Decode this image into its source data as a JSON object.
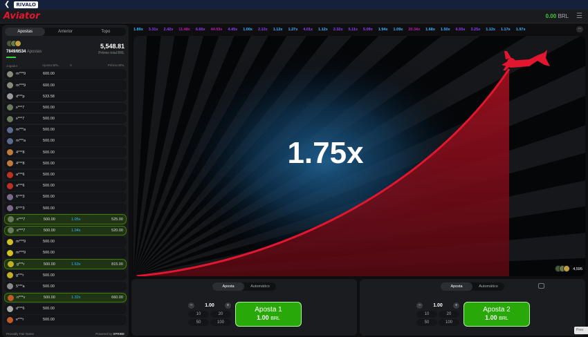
{
  "topbar": {
    "back_icon": "chevron-left-icon",
    "brand": "RIVALO"
  },
  "header": {
    "logo": "Aviator",
    "balance": "0.00",
    "currency": "BRL"
  },
  "sidebar": {
    "tabs": [
      "Apostas",
      "Anterior",
      "Topo"
    ],
    "active_tab": "Apostas",
    "players_count": "7849/8534",
    "players_label": "Apostas",
    "total": "5,548.81",
    "total_label": "Prêmio total BRL",
    "columns": {
      "player": "Jogador",
      "bet": "Aposta BRL",
      "x": "X",
      "win": "Prêmio BRL"
    },
    "rows": [
      {
        "player": "m***9",
        "bet": "600.00",
        "x": "",
        "win": "",
        "win_state": false,
        "avatar": "#8a8a7a"
      },
      {
        "player": "m***9",
        "bet": "600.00",
        "x": "",
        "win": "",
        "win_state": false,
        "avatar": "#8a8a7a"
      },
      {
        "player": "d***p",
        "bet": "533.58",
        "x": "",
        "win": "",
        "win_state": false,
        "avatar": "#9a9a9a"
      },
      {
        "player": "s***7",
        "bet": "500.00",
        "x": "",
        "win": "",
        "win_state": false,
        "avatar": "#6a7a5a"
      },
      {
        "player": "s***7",
        "bet": "500.00",
        "x": "",
        "win": "",
        "win_state": false,
        "avatar": "#6a7a5a"
      },
      {
        "player": "m***a",
        "bet": "500.00",
        "x": "",
        "win": "",
        "win_state": false,
        "avatar": "#5a6a8a"
      },
      {
        "player": "m***a",
        "bet": "500.00",
        "x": "",
        "win": "",
        "win_state": false,
        "avatar": "#5a6a8a"
      },
      {
        "player": "4***8",
        "bet": "500.00",
        "x": "",
        "win": "",
        "win_state": false,
        "avatar": "#c07a3a"
      },
      {
        "player": "4***8",
        "bet": "500.00",
        "x": "",
        "win": "",
        "win_state": false,
        "avatar": "#c07a3a"
      },
      {
        "player": "a***6",
        "bet": "500.00",
        "x": "",
        "win": "",
        "win_state": false,
        "avatar": "#c03020"
      },
      {
        "player": "a***6",
        "bet": "500.00",
        "x": "",
        "win": "",
        "win_state": false,
        "avatar": "#c03020"
      },
      {
        "player": "6***3",
        "bet": "500.00",
        "x": "",
        "win": "",
        "win_state": false,
        "avatar": "#7a6a8a"
      },
      {
        "player": "6***3",
        "bet": "500.00",
        "x": "",
        "win": "",
        "win_state": false,
        "avatar": "#7a6a8a"
      },
      {
        "player": "s***7",
        "bet": "500.00",
        "x": "1.05x",
        "win": "525.00",
        "win_state": true,
        "avatar": "#6a7a5a"
      },
      {
        "player": "s***7",
        "bet": "500.00",
        "x": "1.04x",
        "win": "520.00",
        "win_state": true,
        "avatar": "#6a7a5a"
      },
      {
        "player": "m***9",
        "bet": "500.00",
        "x": "",
        "win": "",
        "win_state": false,
        "avatar": "#d0c020"
      },
      {
        "player": "m***9",
        "bet": "500.00",
        "x": "",
        "win": "",
        "win_state": false,
        "avatar": "#d0c020"
      },
      {
        "player": "g***r",
        "bet": "500.00",
        "x": "1.63x",
        "win": "815.00",
        "win_state": true,
        "avatar": "#c0b020"
      },
      {
        "player": "g***r",
        "bet": "500.00",
        "x": "",
        "win": "",
        "win_state": false,
        "avatar": "#c0b020"
      },
      {
        "player": "5***a",
        "bet": "500.00",
        "x": "",
        "win": "",
        "win_state": false,
        "avatar": "#8a8a8a"
      },
      {
        "player": "n***v",
        "bet": "500.00",
        "x": "1.32x",
        "win": "660.00",
        "win_state": true,
        "avatar": "#c05a2a"
      },
      {
        "player": "d***6",
        "bet": "500.00",
        "x": "",
        "win": "",
        "win_state": false,
        "avatar": "#aaaaaa"
      },
      {
        "player": "e***r",
        "bet": "500.00",
        "x": "",
        "win": "",
        "win_state": false,
        "avatar": "#c05a2a"
      }
    ],
    "footer_left": "Provably Fair Game",
    "footer_right_label": "Powered by",
    "footer_right_brand": "SPRIBE"
  },
  "history": [
    {
      "v": "1.89x",
      "c": "#34b4ff"
    },
    {
      "v": "3.31x",
      "c": "#913ef8"
    },
    {
      "v": "2.42x",
      "c": "#913ef8"
    },
    {
      "v": "11.48x",
      "c": "#c017b4"
    },
    {
      "v": "6.66x",
      "c": "#913ef8"
    },
    {
      "v": "44.03x",
      "c": "#c017b4"
    },
    {
      "v": "4.45x",
      "c": "#913ef8"
    },
    {
      "v": "1.00x",
      "c": "#34b4ff"
    },
    {
      "v": "2.12x",
      "c": "#913ef8"
    },
    {
      "v": "1.12x",
      "c": "#34b4ff"
    },
    {
      "v": "1.27x",
      "c": "#34b4ff"
    },
    {
      "v": "4.01x",
      "c": "#913ef8"
    },
    {
      "v": "1.12x",
      "c": "#34b4ff"
    },
    {
      "v": "2.32x",
      "c": "#913ef8"
    },
    {
      "v": "5.11x",
      "c": "#913ef8"
    },
    {
      "v": "5.09x",
      "c": "#913ef8"
    },
    {
      "v": "1.94x",
      "c": "#34b4ff"
    },
    {
      "v": "1.09x",
      "c": "#34b4ff"
    },
    {
      "v": "20.34x",
      "c": "#c017b4"
    },
    {
      "v": "1.68x",
      "c": "#34b4ff"
    },
    {
      "v": "1.50x",
      "c": "#34b4ff"
    },
    {
      "v": "6.55x",
      "c": "#913ef8"
    },
    {
      "v": "3.25x",
      "c": "#913ef8"
    },
    {
      "v": "1.12x",
      "c": "#34b4ff"
    },
    {
      "v": "1.17x",
      "c": "#34b4ff"
    },
    {
      "v": "1.97x",
      "c": "#34b4ff"
    }
  ],
  "game": {
    "multiplier": "1.75x",
    "online_players": "4,595"
  },
  "panels": [
    {
      "tab_bet": "Aposta",
      "tab_auto": "Automático",
      "amount": "1.00",
      "quick": [
        "10",
        "20",
        "50",
        "100"
      ],
      "button_title": "Aposta 1",
      "button_amount": "1.00",
      "button_currency": "BRL"
    },
    {
      "tab_bet": "Aposta",
      "tab_auto": "Automático",
      "amount": "1.00",
      "quick": [
        "10",
        "20",
        "50",
        "100"
      ],
      "button_title": "Aposta 2",
      "button_amount": "1.00",
      "button_currency": "BRL"
    }
  ],
  "prev_label": "Prev",
  "colors": {
    "accent_red": "#e2172f",
    "win_green": "#28a909",
    "low_mult": "#34b4ff",
    "mid_mult": "#913ef8",
    "high_mult": "#c017b4"
  }
}
